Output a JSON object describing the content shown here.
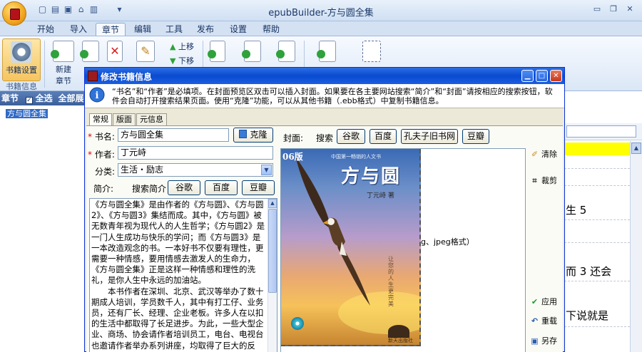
{
  "app": {
    "title": "epubBuilder-方与圆全集"
  },
  "icons": {
    "qat": [
      "new-file-icon",
      "open-folder-icon",
      "save-icon",
      "home-icon",
      "book-icon",
      "dropdown-arrow-icon"
    ],
    "window": [
      "minimize-icon",
      "restore-icon",
      "close-icon"
    ]
  },
  "tabs": [
    {
      "label": "开始"
    },
    {
      "label": "导入"
    },
    {
      "label": "章节"
    },
    {
      "label": "编辑"
    },
    {
      "label": "工具"
    },
    {
      "label": "发布"
    },
    {
      "label": "设置"
    },
    {
      "label": "帮助"
    }
  ],
  "ribbon": {
    "book_settings_label": "书籍设置",
    "book_info_group": "书籍信息",
    "new_chapter_label_1": "新建",
    "new_chapter_label_2": "章节",
    "move_up_label": "上移",
    "move_down_label": "下移"
  },
  "left_panel": {
    "head_chapter": "章节",
    "head_select_all": "全选",
    "head_expand_all": "全部展",
    "tree_root": "方与圆全集"
  },
  "right_panel": {
    "texts": [
      "生 5",
      "而 3 还会",
      "下说就是"
    ]
  },
  "dialog": {
    "title": "修改书籍信息",
    "info_text": "“书名”和“作者”是必填项。在封面预览区双击可以插入封面。如果要在各主要网站搜索“简介”和“封面”请按相应的搜索按钮，软件会自动打开搜索结果页面。使用“克隆”功能，可以从其他书籍（.ebb格式）中复制书籍信息。",
    "tabs": [
      "常规",
      "版面",
      "元信息"
    ],
    "book_name_label": "书名:",
    "book_name_value": "方与圆全集",
    "clone_button": "克隆",
    "author_label": "作者:",
    "author_value": "丁元峙",
    "category_label": "分类:",
    "category_value": "生活・励志",
    "summary_label": "简介:",
    "search_summary_label": "搜索简介",
    "cover_label": "封面:",
    "search_label": "搜索",
    "google_button": "谷歌",
    "baidu_button": "百度",
    "kongfuzi_button": "孔夫子旧书网",
    "douban_button": "豆瓣",
    "summary_text": "《方与圆全集》是由作者的《方与圆》、《方与圆2》、《方与圆3》集结而成。其中，《方与圆》被无数青年视为现代人的人生哲学；《方与圆2》是一门人生成功与快乐的学问；而《方与圆3》是一本改造观念的书。一本好书不仅要有理性，更需要一种情感，要用情感去激发人的生命力，《方与圆全集》正是这样一种情感和理性的洗礼，是你人生中永远的加油站。\n　　本书作者在深圳、北京、武汉等举办了数十期成人培训，学员数千人，其中有打工仔、业务员，还有厂长、经理、企业老板。许多人在以扣的生活中都取得了长足进步。为此，一些大型企业、商场、协会请作者培训员工，电台、电视台也邀请作者举办系列讲座，均取得了巨大的反响。正是在这个基础上，作者精心",
    "cover_hint": "g、jpeg格式）",
    "cover_image": {
      "edition": "06版",
      "series": "中国第一畅销的人文书",
      "title": "方与圆",
      "author": "丁元峙 著",
      "vertical_text": "让您的人生更完美",
      "publisher": "新天出版社"
    },
    "clear_button": "清除",
    "crop_button": "裁剪",
    "apply_button": "应用",
    "reset_button": "重载",
    "save_as_button": "另存"
  }
}
